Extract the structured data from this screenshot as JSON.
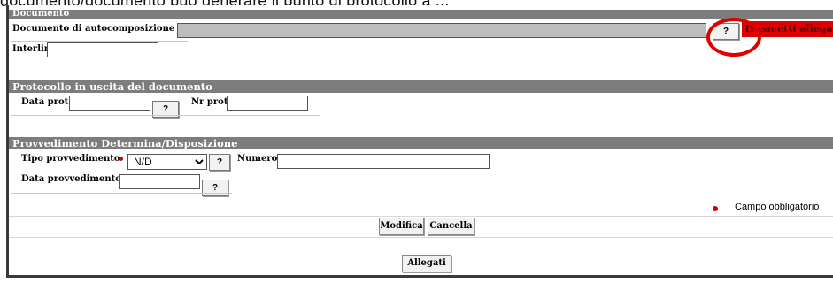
{
  "caption": "documento/documento può generare il punto di protocollo a ...",
  "sections": {
    "documento": {
      "title": "Documento",
      "autocomp_label": "Documento di autocomposizione",
      "help_label": "?",
      "transmit_label": "Trasmetti allegati",
      "interlinea_label": "Interlinea"
    },
    "protocollo": {
      "title": "Protocollo in uscita del documento",
      "data_prot_label": "Data prot",
      "help_label": "?",
      "nr_prot_label": "Nr prot"
    },
    "provvedimento": {
      "title": "Provvedimento Determina/Disposizione",
      "tipo_label": "Tipo provvedimento",
      "tipo_value": "N/D",
      "help_label": "?",
      "numero_label": "Numero",
      "data_label": "Data provvedimento",
      "data_help_label": "?"
    }
  },
  "legend": {
    "required_label": "Campo obbligatorio",
    "dot_color": "#d00000"
  },
  "actions": {
    "modifica": "Modifica",
    "cancella": "Cancella",
    "allegati": "Allegati"
  },
  "colors": {
    "section_bar": "#7d7d7d",
    "highlight": "#e00000"
  }
}
